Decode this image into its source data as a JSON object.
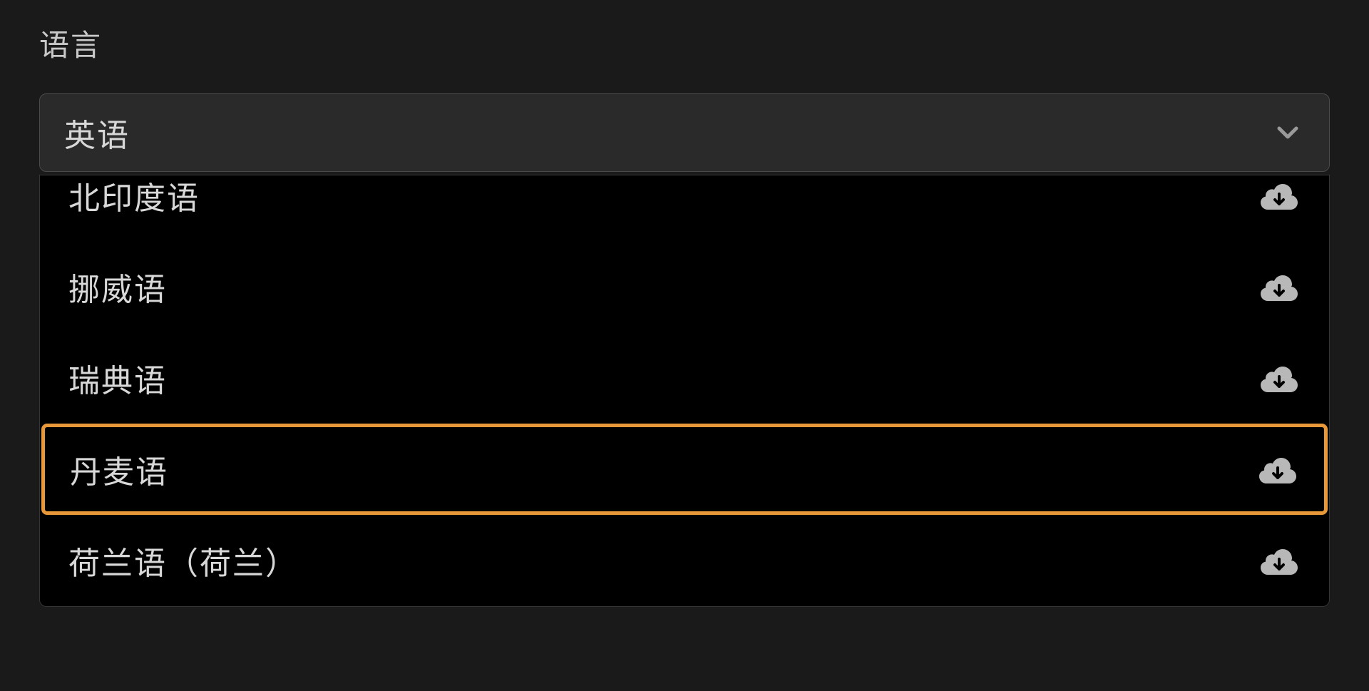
{
  "language": {
    "section_label": "语言",
    "selected": "英语",
    "options": [
      {
        "label": "北印度语",
        "downloadable": true
      },
      {
        "label": "挪威语",
        "downloadable": true
      },
      {
        "label": "瑞典语",
        "downloadable": true
      },
      {
        "label": "丹麦语",
        "downloadable": true,
        "highlighted": true
      },
      {
        "label": "荷兰语（荷兰）",
        "downloadable": true
      }
    ]
  },
  "icons": {
    "chevron_down": "chevron-down-icon",
    "cloud_download": "cloud-download-icon"
  },
  "colors": {
    "highlight": "#e89838",
    "icon": "#b8b8b8"
  }
}
